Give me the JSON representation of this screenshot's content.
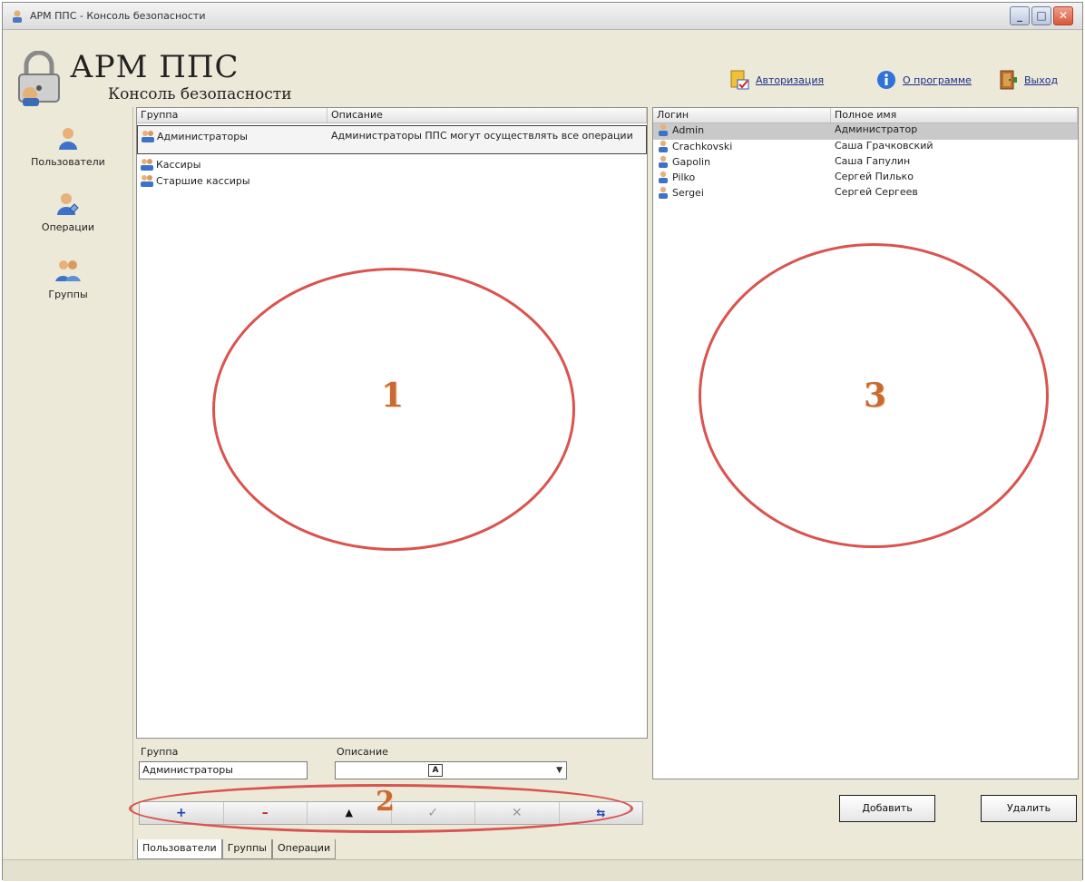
{
  "window": {
    "title": "АРМ ППС - Консоль безопасности",
    "controls": {
      "minimize": "_",
      "maximize": "□",
      "close": "✕"
    }
  },
  "header": {
    "app_name": "АРМ ППС",
    "subtitle": "Консоль безопасности",
    "links": [
      {
        "label": "Авторизация",
        "icon": "authorization-icon"
      },
      {
        "label": "О программе",
        "icon": "info-icon"
      },
      {
        "label": "Выход",
        "icon": "exit-door-icon"
      }
    ]
  },
  "nav": {
    "items": [
      {
        "label": "Пользователи",
        "icon": "user-icon"
      },
      {
        "label": "Операции",
        "icon": "user-operation-icon"
      },
      {
        "label": "Группы",
        "icon": "users-group-icon"
      }
    ]
  },
  "groups_grid": {
    "columns": [
      "Группа",
      "Описание"
    ],
    "rows": [
      {
        "name": "Администраторы",
        "description": "Администраторы ППС могут осуществлять все операции",
        "selected": true
      },
      {
        "name": "Кассиры",
        "description": ""
      },
      {
        "name": "Старшие кассиры",
        "description": ""
      }
    ]
  },
  "users_grid": {
    "columns": [
      "Логин",
      "Полное имя"
    ],
    "rows": [
      {
        "login": "Admin",
        "full_name": "Администратор",
        "selected": true
      },
      {
        "login": "Crachkovski",
        "full_name": "Саша Грачковский"
      },
      {
        "login": "Gapolin",
        "full_name": "Саша Гапулин"
      },
      {
        "login": "Pilko",
        "full_name": "Сергей Пилько"
      },
      {
        "login": "Sergei",
        "full_name": "Сергей Сергеев"
      }
    ]
  },
  "form": {
    "group_label": "Группа",
    "group_value": "Администраторы",
    "description_label": "Описание",
    "description_value": "",
    "combo_button": "A"
  },
  "toolbar": {
    "add": "+",
    "remove": "–",
    "up": "▲",
    "apply": "✓",
    "cancel": "✕",
    "refresh": "⇆"
  },
  "buttons": {
    "add": "Добавить",
    "delete": "Удалить"
  },
  "tabs": [
    "Пользователи",
    "Группы",
    "Операции"
  ],
  "annotations": [
    "1",
    "2",
    "3"
  ],
  "colors": {
    "annotation": "#d9534f",
    "annotation_number": "#c96a33",
    "window_bg": "#ece9d8"
  }
}
